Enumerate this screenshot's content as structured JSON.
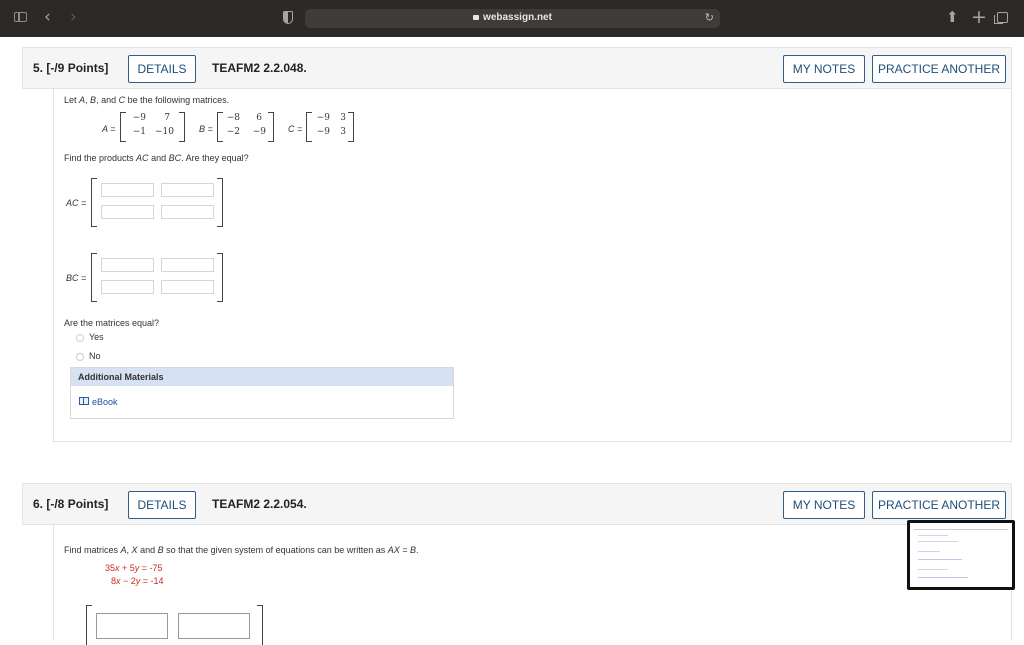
{
  "browser": {
    "url": "webassign.net",
    "icons": [
      "sidebar-icon",
      "back-icon",
      "forward-icon",
      "shield-icon",
      "lock-icon",
      "reload-icon",
      "share-icon",
      "new-tab-icon",
      "tabs-icon"
    ]
  },
  "q5": {
    "number": "5.",
    "points": "[-/9 Points]",
    "details": "DETAILS",
    "code": "TEAFM2 2.2.048.",
    "my_notes": "MY NOTES",
    "practice": "PRACTICE ANOTHER",
    "intro": {
      "pre": "Let ",
      "a": "A",
      "c1": ", ",
      "b": "B",
      "c2": ", and ",
      "c": "C",
      "post": " be the following matrices."
    },
    "matrices": {
      "A_label": "A =",
      "A": [
        "−9",
        "7",
        "−1",
        "−10"
      ],
      "B_label": "B =",
      "B": [
        "−8",
        "6",
        "−2",
        "−9"
      ],
      "C_label": "C =",
      "C": [
        "−9",
        "3",
        "−9",
        "3"
      ]
    },
    "question": {
      "pre": "Find the products ",
      "ac": "AC",
      "and": " and ",
      "bc": "BC",
      "post": ". Are they equal?"
    },
    "ac_label": "AC =",
    "bc_label": "BC =",
    "equal_q": "Are the matrices equal?",
    "options": [
      "Yes",
      "No"
    ],
    "additional": "Additional Materials",
    "ebook": "eBook"
  },
  "q6": {
    "number": "6.",
    "points": "[-/8 Points]",
    "details": "DETAILS",
    "code": "TEAFM2 2.2.054.",
    "my_notes": "MY NOTES",
    "practice": "PRACTICE ANOTHER",
    "prompt": {
      "pre": "Find matrices ",
      "a": "A",
      "c1": ", ",
      "x": "X",
      "c2": " and ",
      "b": "B",
      "mid": " so that the given system of equations can be written as ",
      "eq": "AX = B",
      "post": "."
    },
    "equations": [
      {
        "c1": "35",
        "v1": "x",
        "op": " + ",
        "c2": "5",
        "v2": "y",
        "rhs": " = -75"
      },
      {
        "c1": "8",
        "v1": "x",
        "op": " − ",
        "c2": "2",
        "v2": "y",
        "rhs": " = -14"
      }
    ]
  }
}
